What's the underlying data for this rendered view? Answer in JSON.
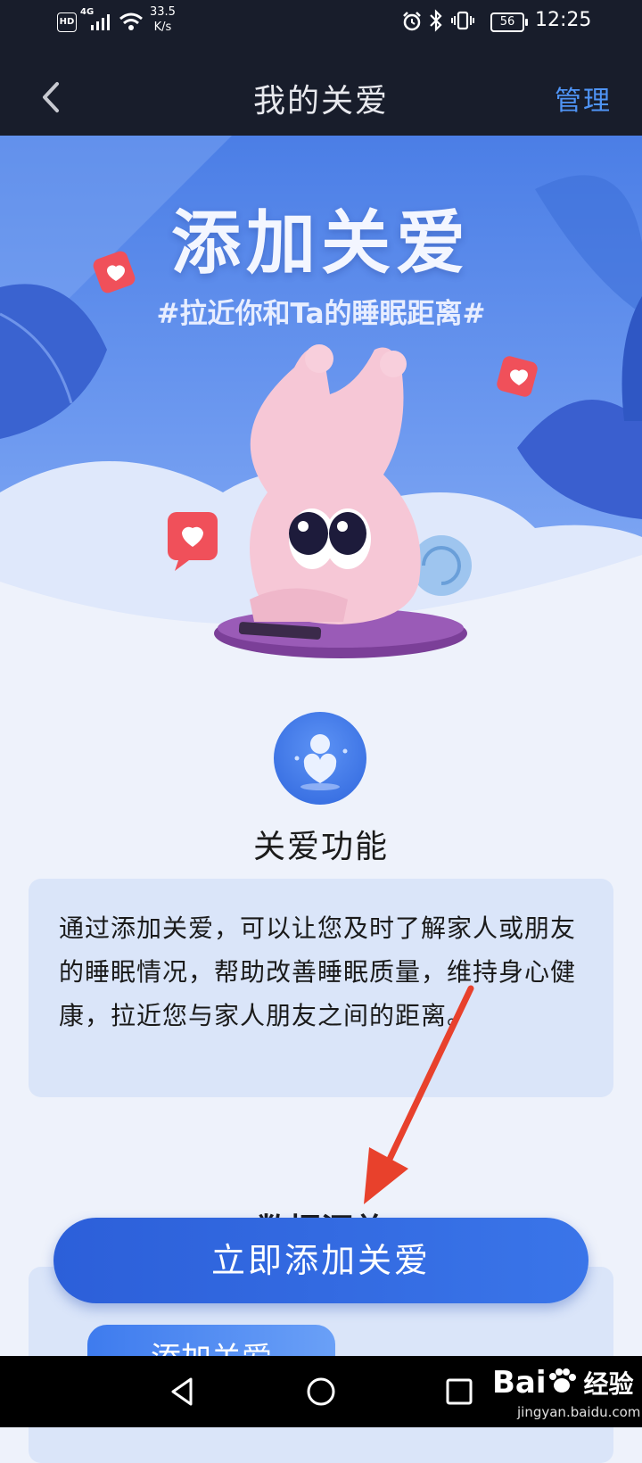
{
  "status_bar": {
    "hd": "HD",
    "signal": "4G",
    "net_speed_value": "33.5",
    "net_speed_unit": "K/s",
    "battery": "56",
    "time": "12:25",
    "icons": [
      "hd-icon",
      "signal-icon",
      "wifi-icon",
      "alarm-icon",
      "bluetooth-icon",
      "vibrate-icon",
      "battery-icon"
    ]
  },
  "header": {
    "title": "我的关爱",
    "manage_label": "管理",
    "back_icon": "chevron-left-icon"
  },
  "banner": {
    "title": "添加关爱",
    "subtitle": "#拉近你和Ta的睡眠距离#",
    "colors": {
      "sky": "#4b7ee6",
      "cloud": "#eef2fb",
      "heart_badge": "#f0505a"
    }
  },
  "feature": {
    "icon": "person-heart-icon",
    "title": "关爱功能",
    "description": "通过添加关爱，可以让您及时了解家人或朋友的睡眠情况，帮助改善睡眠质量，维持身心健康，拉近您与家人朋友之间的距离。"
  },
  "data_section": {
    "title": "数据汇总",
    "button_label": "添加关爱"
  },
  "cta": {
    "label": "立即添加关爱",
    "color": "#2f66dd"
  },
  "annotation": {
    "arrow_color": "#e8412c"
  },
  "navbar": {
    "icons": [
      "back-triangle-icon",
      "home-circle-icon",
      "recents-square-icon"
    ]
  },
  "watermark": {
    "brand": "Bai",
    "brand_cn": "经验",
    "url": "jingyan.baidu.com"
  }
}
